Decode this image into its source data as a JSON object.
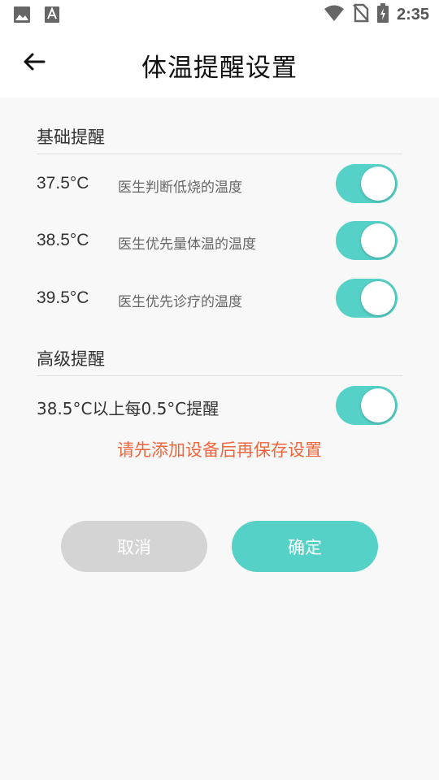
{
  "status_bar": {
    "time": "2:35",
    "icons": [
      "image-icon",
      "text-a-icon",
      "wifi-icon",
      "no-sim-icon",
      "battery-charging-icon"
    ]
  },
  "header": {
    "title": "体温提醒设置",
    "back_icon": "arrow-left-icon"
  },
  "basic": {
    "title": "基础提醒",
    "items": [
      {
        "temp": "37.5°C",
        "desc": "医生判断低烧的温度",
        "enabled": true
      },
      {
        "temp": "38.5°C",
        "desc": "医生优先量体温的温度",
        "enabled": true
      },
      {
        "temp": "39.5°C",
        "desc": "医生优先诊疗的温度",
        "enabled": true
      }
    ]
  },
  "advanced": {
    "title": "高级提醒",
    "label": "38.5°C以上每0.5°C提醒",
    "enabled": true
  },
  "warning": "请先添加设备后再保存设置",
  "buttons": {
    "cancel": "取消",
    "confirm": "确定"
  },
  "colors": {
    "accent": "#55d1c7",
    "warning": "#f0663c",
    "cancel_bg": "#d4d4d4"
  }
}
